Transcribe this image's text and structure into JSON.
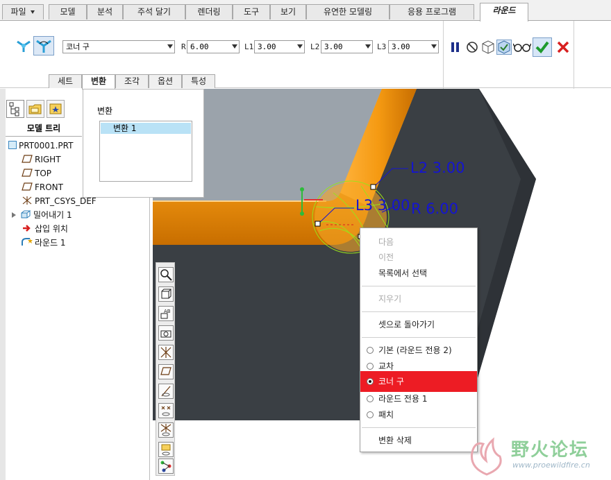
{
  "menu": {
    "file": "파일",
    "tabs": [
      "모델",
      "분석",
      "주석 달기",
      "렌더링",
      "도구",
      "보기",
      "유연한 모델링",
      "응용 프로그램"
    ],
    "active_tab": "라운드"
  },
  "ribbon": {
    "mode_select": "코너 구",
    "r_label": "R",
    "r_value": "6.00",
    "l1_label": "L1",
    "l1_value": "3.00",
    "l2_label": "L2",
    "l2_value": "3.00",
    "l3_label": "L3",
    "l3_value": "3.00",
    "subtabs": [
      "세트",
      "변환",
      "조각",
      "옵션",
      "특성"
    ],
    "active_subtab": "변환"
  },
  "popup": {
    "label": "변환",
    "items": [
      "변환 1"
    ]
  },
  "model_tree": {
    "title": "모델 트리",
    "items": [
      "PRT0001.PRT",
      "RIGHT",
      "TOP",
      "FRONT",
      "PRT_CSYS_DEF",
      "밀어내기 1",
      "삽입 위치",
      "라운드 1"
    ]
  },
  "dimensions": {
    "l2": "L2  3.00",
    "l3": "L3  3.00",
    "r": "R  6.00"
  },
  "context_menu": {
    "next": "다음",
    "prev": "이전",
    "pick_from_list": "목록에서 선택",
    "clear": "지우기",
    "back_to_set": "셋으로 돌아가기",
    "options": [
      "기본 (라운드 전용 2)",
      "교차",
      "코너 구",
      "라운드 전용 1",
      "패치"
    ],
    "selected_option": "코너 구",
    "delete_transition": "변환 삭제"
  },
  "watermark": {
    "title": "野火论坛",
    "url": "www.proewildfire.cn"
  },
  "colors": {
    "accent_selected": "#ed1c24",
    "fillet_orange": "#f59a12",
    "dimension_blue": "#1414d2",
    "solid_dark": "#3a3f44"
  }
}
